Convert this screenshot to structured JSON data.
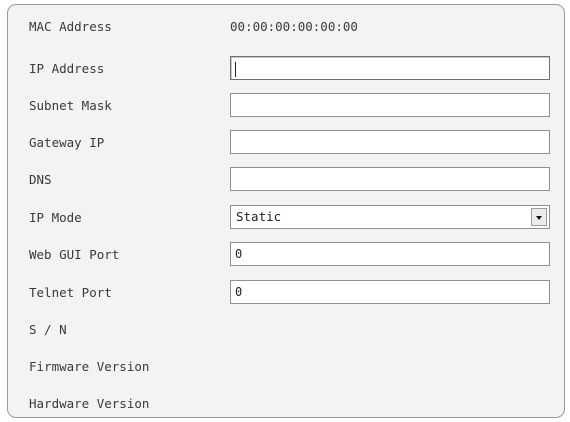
{
  "mac": {
    "label": "MAC Address",
    "value": "00:00:00:00:00:00"
  },
  "ip": {
    "label": "IP Address",
    "value": ""
  },
  "subnet": {
    "label": "Subnet Mask",
    "value": ""
  },
  "gateway": {
    "label": "Gateway IP",
    "value": ""
  },
  "dns": {
    "label": "DNS",
    "value": ""
  },
  "ip_mode": {
    "label": "IP Mode",
    "selected": "Static"
  },
  "web_port": {
    "label": "Web GUI Port",
    "value": "0"
  },
  "telnet_port": {
    "label": "Telnet Port",
    "value": "0"
  },
  "serial": {
    "label": "S / N",
    "value": ""
  },
  "firmware": {
    "label": "Firmware Version",
    "value": ""
  },
  "hardware": {
    "label": "Hardware Version",
    "value": ""
  },
  "icons": {
    "dropdown": "chevron-down-icon"
  }
}
